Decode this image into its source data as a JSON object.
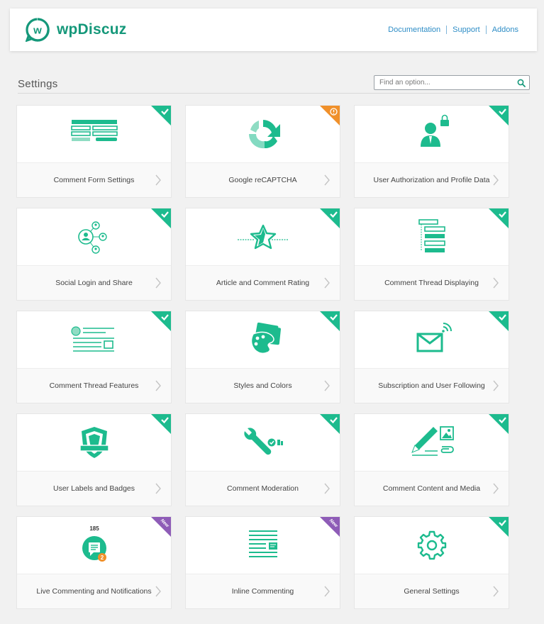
{
  "app": {
    "brand_name": "wpDiscuz",
    "logo_letter": "w",
    "brand_color": "#15987a",
    "accent_color": "#1dbb8e"
  },
  "nav": {
    "items": [
      {
        "label": "Documentation"
      },
      {
        "label": "Support"
      },
      {
        "label": "Addons"
      }
    ]
  },
  "page": {
    "title": "Settings"
  },
  "search": {
    "placeholder": "Find an option..."
  },
  "cards": [
    {
      "label": "Comment Form Settings",
      "icon": "form-icon",
      "badge": "check"
    },
    {
      "label": "Google reCAPTCHA",
      "icon": "recaptcha-icon",
      "badge": "warning"
    },
    {
      "label": "User Authorization and Profile Data",
      "icon": "user-lock-icon",
      "badge": "check"
    },
    {
      "label": "Social Login and Share",
      "icon": "social-network-icon",
      "badge": "check"
    },
    {
      "label": "Article and Comment Rating",
      "icon": "star-rating-icon",
      "badge": "check"
    },
    {
      "label": "Comment Thread Displaying",
      "icon": "thread-tree-icon",
      "badge": "check"
    },
    {
      "label": "Comment Thread Features",
      "icon": "thread-features-icon",
      "badge": "check"
    },
    {
      "label": "Styles and Colors",
      "icon": "palette-icon",
      "badge": "check"
    },
    {
      "label": "Subscription and User Following",
      "icon": "envelope-icon",
      "badge": "check"
    },
    {
      "label": "User Labels and Badges",
      "icon": "shield-badge-icon",
      "badge": "check"
    },
    {
      "label": "Comment Moderation",
      "icon": "wrench-icon",
      "badge": "check"
    },
    {
      "label": "Comment Content and Media",
      "icon": "pencil-media-icon",
      "badge": "check"
    },
    {
      "label": "Live Commenting and Notifications",
      "icon": "live-chat-icon",
      "badge": "new",
      "counter": "185",
      "notice_count": "2"
    },
    {
      "label": "Inline Commenting",
      "icon": "inline-comment-icon",
      "badge": "new"
    },
    {
      "label": "General Settings",
      "icon": "gear-icon",
      "badge": "check"
    }
  ],
  "badges": {
    "new_text": "New",
    "check_color": "#1dbb8e",
    "warning_color": "#f0902a",
    "new_color": "#8e5cb7"
  }
}
